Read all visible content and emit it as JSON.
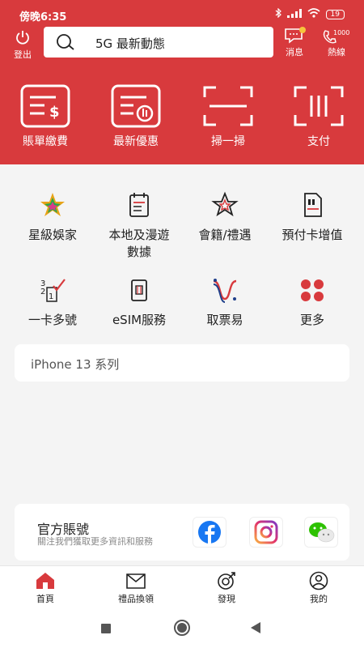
{
  "status": {
    "time": "傍晚6:35",
    "battery": "19"
  },
  "topbar": {
    "logout_label": "登出",
    "search_text": "5G 最新動態",
    "messages_label": "消息",
    "hotline_label": "熱線",
    "hotline_number": "1000"
  },
  "quick_actions": [
    {
      "label": "賬單繳費",
      "icon": "bill-payment-icon"
    },
    {
      "label": "最新優惠",
      "icon": "offers-icon"
    },
    {
      "label": "掃一掃",
      "icon": "scan-icon"
    },
    {
      "label": "支付",
      "icon": "payment-icon"
    }
  ],
  "services": [
    {
      "label": "星級娛家",
      "icon": "star-entertainment-icon"
    },
    {
      "label": "本地及漫遊數據",
      "icon": "calendar-data-icon"
    },
    {
      "label": "會籍/禮遇",
      "icon": "membership-star-icon"
    },
    {
      "label": "預付卡增值",
      "icon": "sim-topup-icon"
    },
    {
      "label": "一卡多號",
      "icon": "multi-number-icon"
    },
    {
      "label": "eSIM服務",
      "icon": "esim-icon"
    },
    {
      "label": "取票易",
      "icon": "ticket-icon"
    },
    {
      "label": "更多",
      "icon": "more-dots-icon"
    }
  ],
  "promo": {
    "text": "iPhone 13 系列"
  },
  "official": {
    "title": "官方賬號",
    "subtitle": "關注我們獲取更多資訊和服務",
    "accounts": [
      "facebook",
      "instagram",
      "wechat"
    ]
  },
  "bottom_nav": [
    {
      "label": "首頁",
      "icon": "home-icon",
      "active": true
    },
    {
      "label": "禮品換領",
      "icon": "gift-box-icon"
    },
    {
      "label": "發現",
      "icon": "discover-icon"
    },
    {
      "label": "我的",
      "icon": "profile-icon"
    }
  ],
  "colors": {
    "brand_red": "#d83a3d",
    "badge_yellow": "#f6c43c"
  }
}
